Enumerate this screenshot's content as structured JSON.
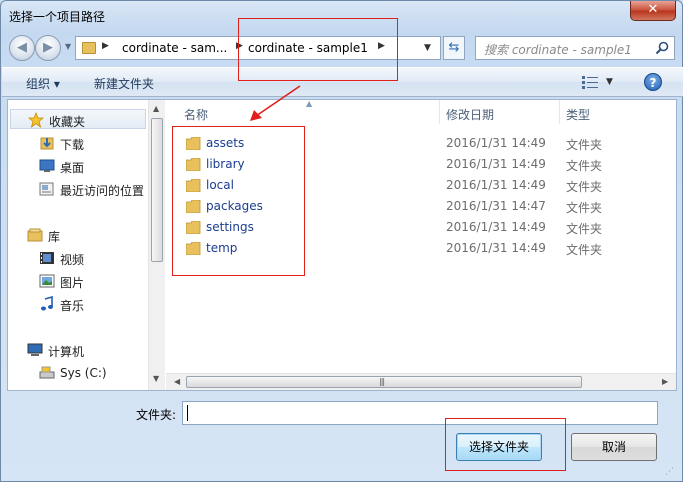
{
  "window": {
    "title": "选择一个项目路径",
    "close_label": "✕"
  },
  "nav": {
    "back_icon": "back-arrow-icon",
    "forward_icon": "forward-arrow-icon",
    "breadcrumbs": [
      "cordinate - sam...",
      "cordinate - sample1"
    ],
    "refresh_icon": "refresh-icon",
    "search_placeholder": "搜索 cordinate - sample1"
  },
  "toolbar": {
    "organize_label": "组织 ▾",
    "new_folder_label": "新建文件夹",
    "view_icon": "view-options-icon",
    "help_label": "?"
  },
  "sidebar": {
    "favorites": {
      "label": "收藏夹",
      "items": [
        {
          "label": "下载",
          "icon": "downloads-icon"
        },
        {
          "label": "桌面",
          "icon": "desktop-icon"
        },
        {
          "label": "最近访问的位置",
          "icon": "recent-places-icon"
        }
      ]
    },
    "libraries": {
      "label": "库",
      "items": [
        {
          "label": "视频",
          "icon": "videos-icon"
        },
        {
          "label": "图片",
          "icon": "pictures-icon"
        },
        {
          "label": "音乐",
          "icon": "music-icon"
        }
      ]
    },
    "computer": {
      "label": "计算机",
      "items": [
        {
          "label": "Sys (C:)",
          "icon": "drive-icon"
        }
      ]
    }
  },
  "filelist": {
    "columns": {
      "name": "名称",
      "date": "修改日期",
      "type": "类型"
    },
    "rows": [
      {
        "name": "assets",
        "date": "2016/1/31 14:49",
        "type": "文件夹"
      },
      {
        "name": "library",
        "date": "2016/1/31 14:49",
        "type": "文件夹"
      },
      {
        "name": "local",
        "date": "2016/1/31 14:49",
        "type": "文件夹"
      },
      {
        "name": "packages",
        "date": "2016/1/31 14:47",
        "type": "文件夹"
      },
      {
        "name": "settings",
        "date": "2016/1/31 14:49",
        "type": "文件夹"
      },
      {
        "name": "temp",
        "date": "2016/1/31 14:49",
        "type": "文件夹"
      }
    ]
  },
  "footer": {
    "folder_label": "文件夹:",
    "folder_value": "",
    "select_button": "选择文件夹",
    "cancel_button": "取消"
  },
  "colors": {
    "annotation": "#e0201b",
    "folder": "#e8c15d",
    "link_text": "#1a3d8f"
  }
}
